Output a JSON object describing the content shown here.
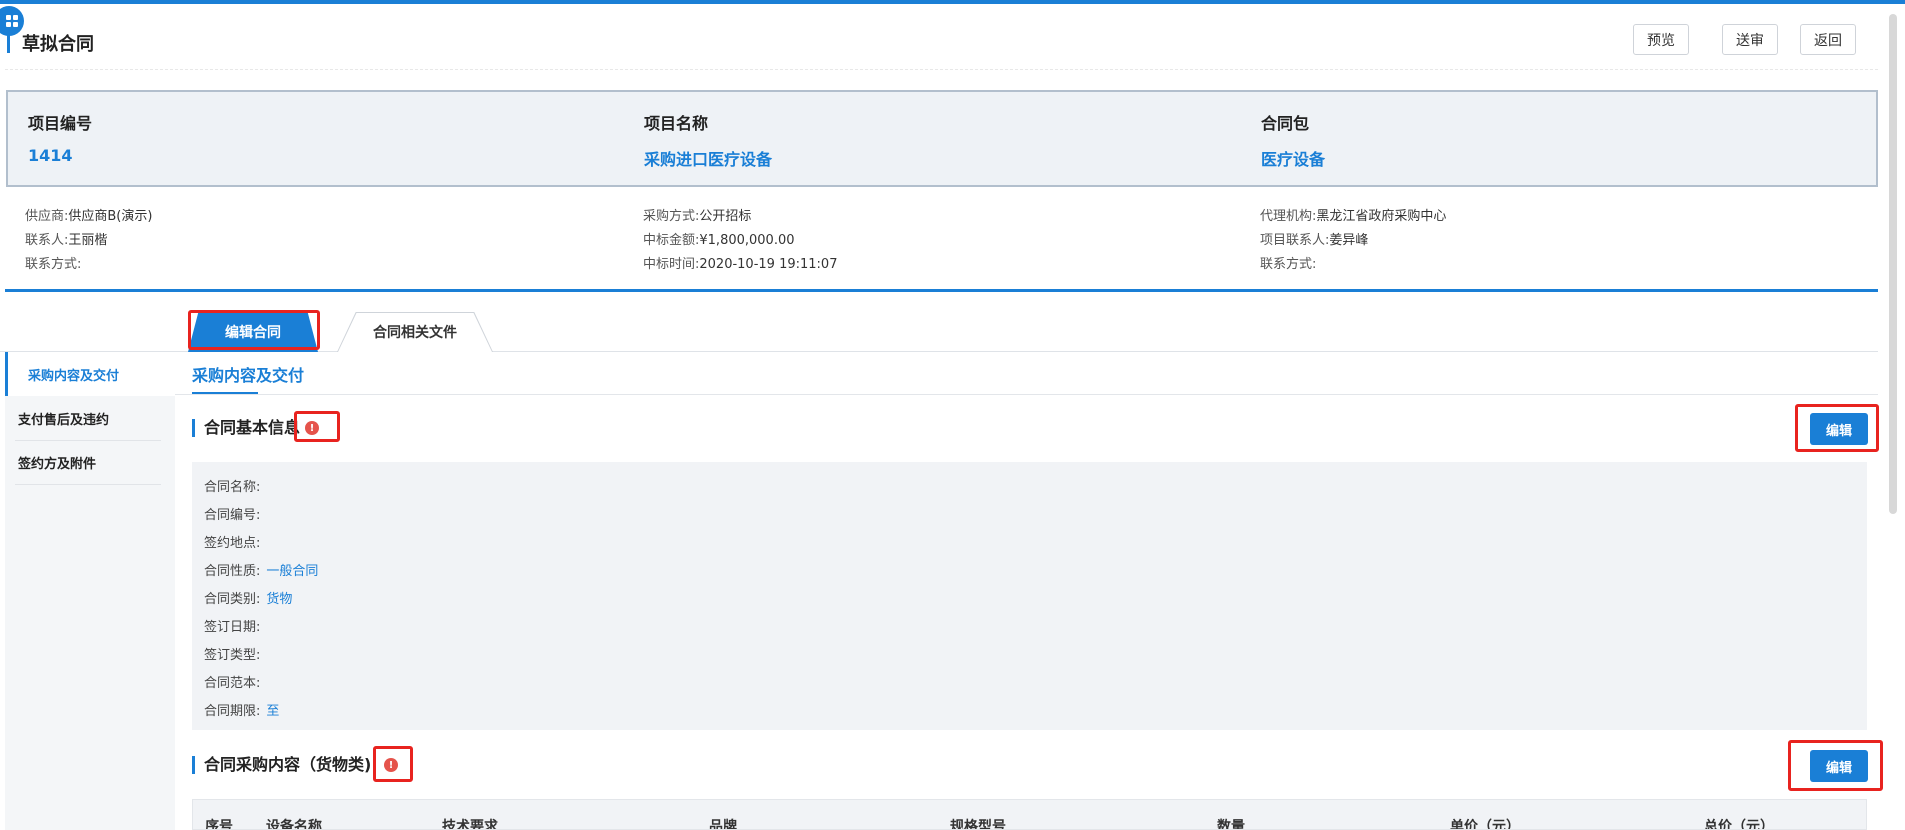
{
  "header": {
    "title": "草拟合同",
    "buttons": {
      "preview": "预览",
      "submit": "送审",
      "back": "返回"
    }
  },
  "project": {
    "number_label": "项目编号",
    "number_value": "1414",
    "name_label": "项目名称",
    "name_value": "采购进口医疗设备",
    "package_label": "合同包",
    "package_value": "医疗设备"
  },
  "details": {
    "left": [
      {
        "label": "供应商:",
        "value": "供应商B(演示)"
      },
      {
        "label": "联系人:",
        "value": "王丽楷"
      },
      {
        "label": "联系方式:",
        "value": ""
      }
    ],
    "middle": [
      {
        "label": "采购方式:",
        "value": "公开招标"
      },
      {
        "label": "中标金额:",
        "value": "¥1,800,000.00"
      },
      {
        "label": "中标时间:",
        "value": "2020-10-19 19:11:07"
      }
    ],
    "right": [
      {
        "label": "代理机构:",
        "value": "黑龙江省政府采购中心"
      },
      {
        "label": "项目联系人:",
        "value": "姜异峰"
      },
      {
        "label": "联系方式:",
        "value": ""
      }
    ]
  },
  "tabs": {
    "edit_contract": "编辑合同",
    "related_files": "合同相关文件"
  },
  "sidebar": {
    "items": [
      {
        "label": "采购内容及交付"
      },
      {
        "label": "支付售后及违约"
      },
      {
        "label": "签约方及附件"
      }
    ]
  },
  "subtab": "采购内容及交付",
  "basic_info": {
    "title": "合同基本信息",
    "edit_label": "编辑",
    "fields": [
      {
        "label": "合同名称:",
        "value": ""
      },
      {
        "label": "合同编号:",
        "value": ""
      },
      {
        "label": "签约地点:",
        "value": ""
      },
      {
        "label": "合同性质:",
        "value": "一般合同"
      },
      {
        "label": "合同类别:",
        "value": "货物"
      },
      {
        "label": "签订日期:",
        "value": ""
      },
      {
        "label": "签订类型:",
        "value": ""
      },
      {
        "label": "合同范本:",
        "value": ""
      },
      {
        "label": "合同期限:",
        "value": "至"
      }
    ]
  },
  "purchase": {
    "title": "合同采购内容（货物类)",
    "edit_label": "编辑",
    "columns": [
      "序号",
      "设备名称",
      "技术要求",
      "品牌",
      "规格型号",
      "数量",
      "单价（元）",
      "总价（元）"
    ]
  },
  "colors": {
    "accent": "#1a7fd6",
    "highlight": "#e8231f",
    "warning": "#e5534b"
  }
}
